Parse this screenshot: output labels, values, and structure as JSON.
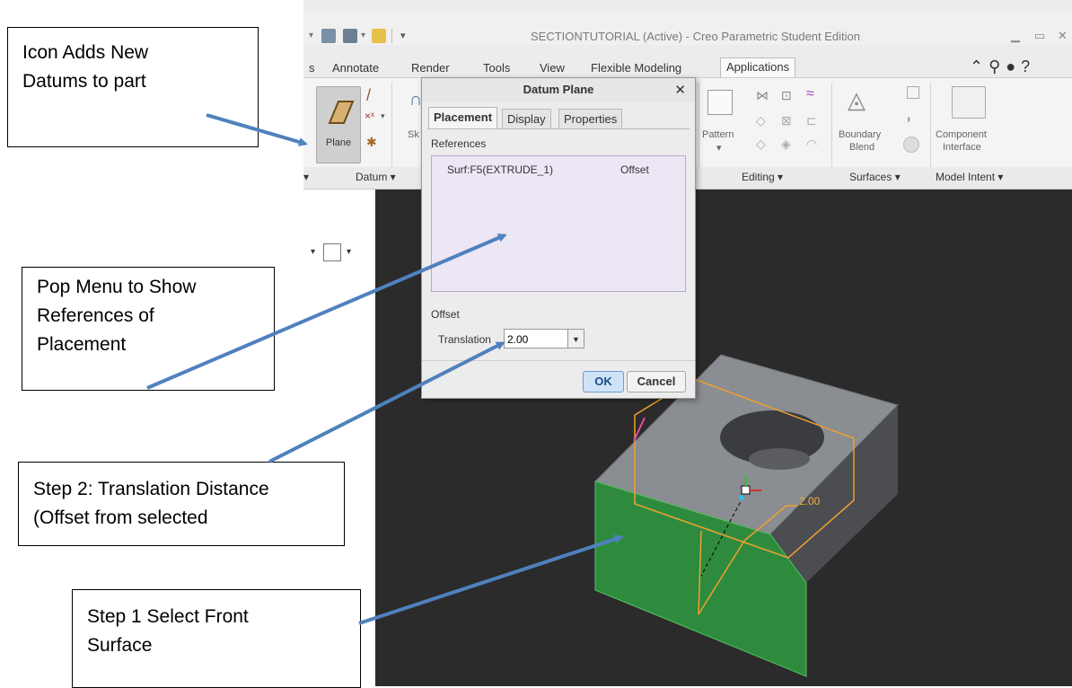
{
  "window": {
    "title": "SECTIONTUTORIAL (Active) - Creo Parametric Student Edition"
  },
  "ribbon": {
    "tabs": [
      "s",
      "Annotate",
      "Render",
      "Tools",
      "View",
      "Flexible Modeling",
      "Applications"
    ],
    "selected_tab": "Applications",
    "plane_label": "Plane",
    "sketch_label": "Sk",
    "pattern_label": "Pattern",
    "boundary_label_1": "Boundary",
    "boundary_label_2": "Blend",
    "component_label_1": "Component",
    "component_label_2": "Interface",
    "groups": {
      "datum": "Datum ▾",
      "editing": "Editing ▾",
      "surfaces": "Surfaces ▾",
      "model_intent": "Model Intent ▾"
    }
  },
  "dialog": {
    "title": "Datum Plane",
    "close": "✕",
    "tabs": [
      "Placement",
      "Display",
      "Properties"
    ],
    "references_label": "References",
    "reference_item": "Surf:F5(EXTRUDE_1)",
    "reference_type": "Offset",
    "offset_label": "Offset",
    "translation_label": "Translation",
    "translation_value": "2.00",
    "ok_label": "OK",
    "cancel_label": "Cancel"
  },
  "viewport": {
    "dimension_value": "2.00"
  },
  "callouts": {
    "icon_adds": [
      "Icon Adds New",
      "Datums to part"
    ],
    "pop_menu": [
      "Pop Menu to Show",
      "References of",
      "Placement"
    ],
    "step2": [
      "Step 2: Translation Distance",
      "(Offset from selected"
    ],
    "step1": [
      "Step 1 Select Front",
      "Surface"
    ]
  },
  "colors": {
    "accent_blue": "#4f81bd",
    "front_face_green": "#2e8b3e",
    "datum_orange": "#f0a030",
    "reference_box": "#ede6f5"
  }
}
